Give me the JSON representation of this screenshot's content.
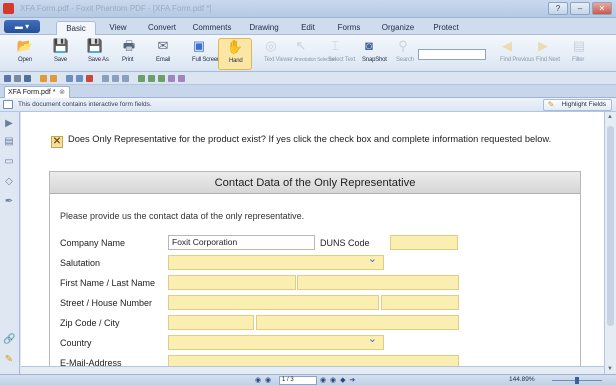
{
  "window": {
    "title": "XFA Form.pdf - Foxit Phantom PDF - [XFA Form.pdf *]",
    "controls": [
      "?",
      "–",
      "✕"
    ]
  },
  "menu_button_label": "▬ ▾",
  "ribbon_tabs": [
    {
      "label": "Basic",
      "active": true
    },
    {
      "label": "View",
      "active": false
    },
    {
      "label": "Convert",
      "active": false
    },
    {
      "label": "Comments",
      "active": false
    },
    {
      "label": "Drawing",
      "active": false
    },
    {
      "label": "Edit",
      "active": false
    },
    {
      "label": "Forms",
      "active": false
    },
    {
      "label": "Organize",
      "active": false
    },
    {
      "label": "Protect",
      "active": false
    }
  ],
  "ribbon_buttons": [
    {
      "label": "Open",
      "icon": "folder-icon",
      "glyph": "📂",
      "color": "#e9b341",
      "enabled": true
    },
    {
      "label": "Save",
      "icon": "save-icon",
      "glyph": "💾",
      "color": "#5877a8",
      "enabled": true
    },
    {
      "label": "Save As",
      "icon": "save-as-icon",
      "glyph": "💾",
      "color": "#5877a8",
      "enabled": true
    },
    {
      "label": "Print",
      "icon": "print-icon",
      "glyph": "🖶",
      "color": "#59667a",
      "enabled": true
    },
    {
      "label": "Email",
      "icon": "email-icon",
      "glyph": "✉",
      "color": "#59667a",
      "enabled": true
    },
    {
      "label": "Full Screen",
      "icon": "fullscreen-icon",
      "glyph": "▣",
      "color": "#3c6fd1",
      "enabled": true
    },
    {
      "label": "Hand",
      "icon": "hand-icon",
      "glyph": "✋",
      "color": "#e6a93a",
      "enabled": true
    },
    {
      "label": "Text Viewer",
      "icon": "text-viewer-icon",
      "glyph": "◎",
      "color": "#9aa6b8",
      "enabled": false
    },
    {
      "label": "Annotation Selection",
      "icon": "annotation-selection-icon",
      "glyph": "↖",
      "color": "#9aa6b8",
      "enabled": false
    },
    {
      "label": "Select Text",
      "icon": "select-text-icon",
      "glyph": "⌶",
      "color": "#9aa6b8",
      "enabled": false
    },
    {
      "label": "SnapShot",
      "icon": "snapshot-icon",
      "glyph": "◙",
      "color": "#45659b",
      "enabled": true
    },
    {
      "label": "Search",
      "icon": "search-icon",
      "glyph": "⚲",
      "color": "#9aa6b8",
      "enabled": false
    },
    {
      "label": "Find Previous",
      "icon": "find-previous-icon",
      "glyph": "◀",
      "color": "#e6c45a",
      "enabled": false
    },
    {
      "label": "Find Next",
      "icon": "find-next-icon",
      "glyph": "▶",
      "color": "#e6c45a",
      "enabled": false
    },
    {
      "label": "Filter",
      "icon": "filter-icon",
      "glyph": "▤",
      "color": "#9aa6b8",
      "enabled": false
    }
  ],
  "document_tab": {
    "label": "XFA Form.pdf *",
    "close": "⊗"
  },
  "info_bar": {
    "message": "This document contains interactive form fields.",
    "highlight_button": "Highlight Fields"
  },
  "form": {
    "checkbox_mark": "✕",
    "question": "Does Only Representative for the product exist? If yes click the check box and complete information requested below.",
    "section_title": "Contact Data of the Only Representative",
    "instructions": "Please provide us the contact data of the only representative.",
    "labels": {
      "company_name": "Company Name",
      "duns_code": "DUNS Code",
      "salutation": "Salutation",
      "first_last_name": "First Name / Last Name",
      "street": "Street / House Number",
      "zip_city": "Zip Code / City",
      "country": "Country",
      "email": "E-Mail-Address"
    },
    "values": {
      "company_name": "Foxit Corporation",
      "duns_code": "",
      "salutation": "",
      "first_name": "",
      "last_name": "",
      "street": "",
      "house_number": "",
      "zip": "",
      "city": "",
      "country": "",
      "email": ""
    }
  },
  "status_bar": {
    "page_field": "1 / 3",
    "zoom": "144.89%",
    "nav_first_prev": "◉ ◉",
    "nav_next_last": "◉ ◉ ◆ ➔"
  }
}
